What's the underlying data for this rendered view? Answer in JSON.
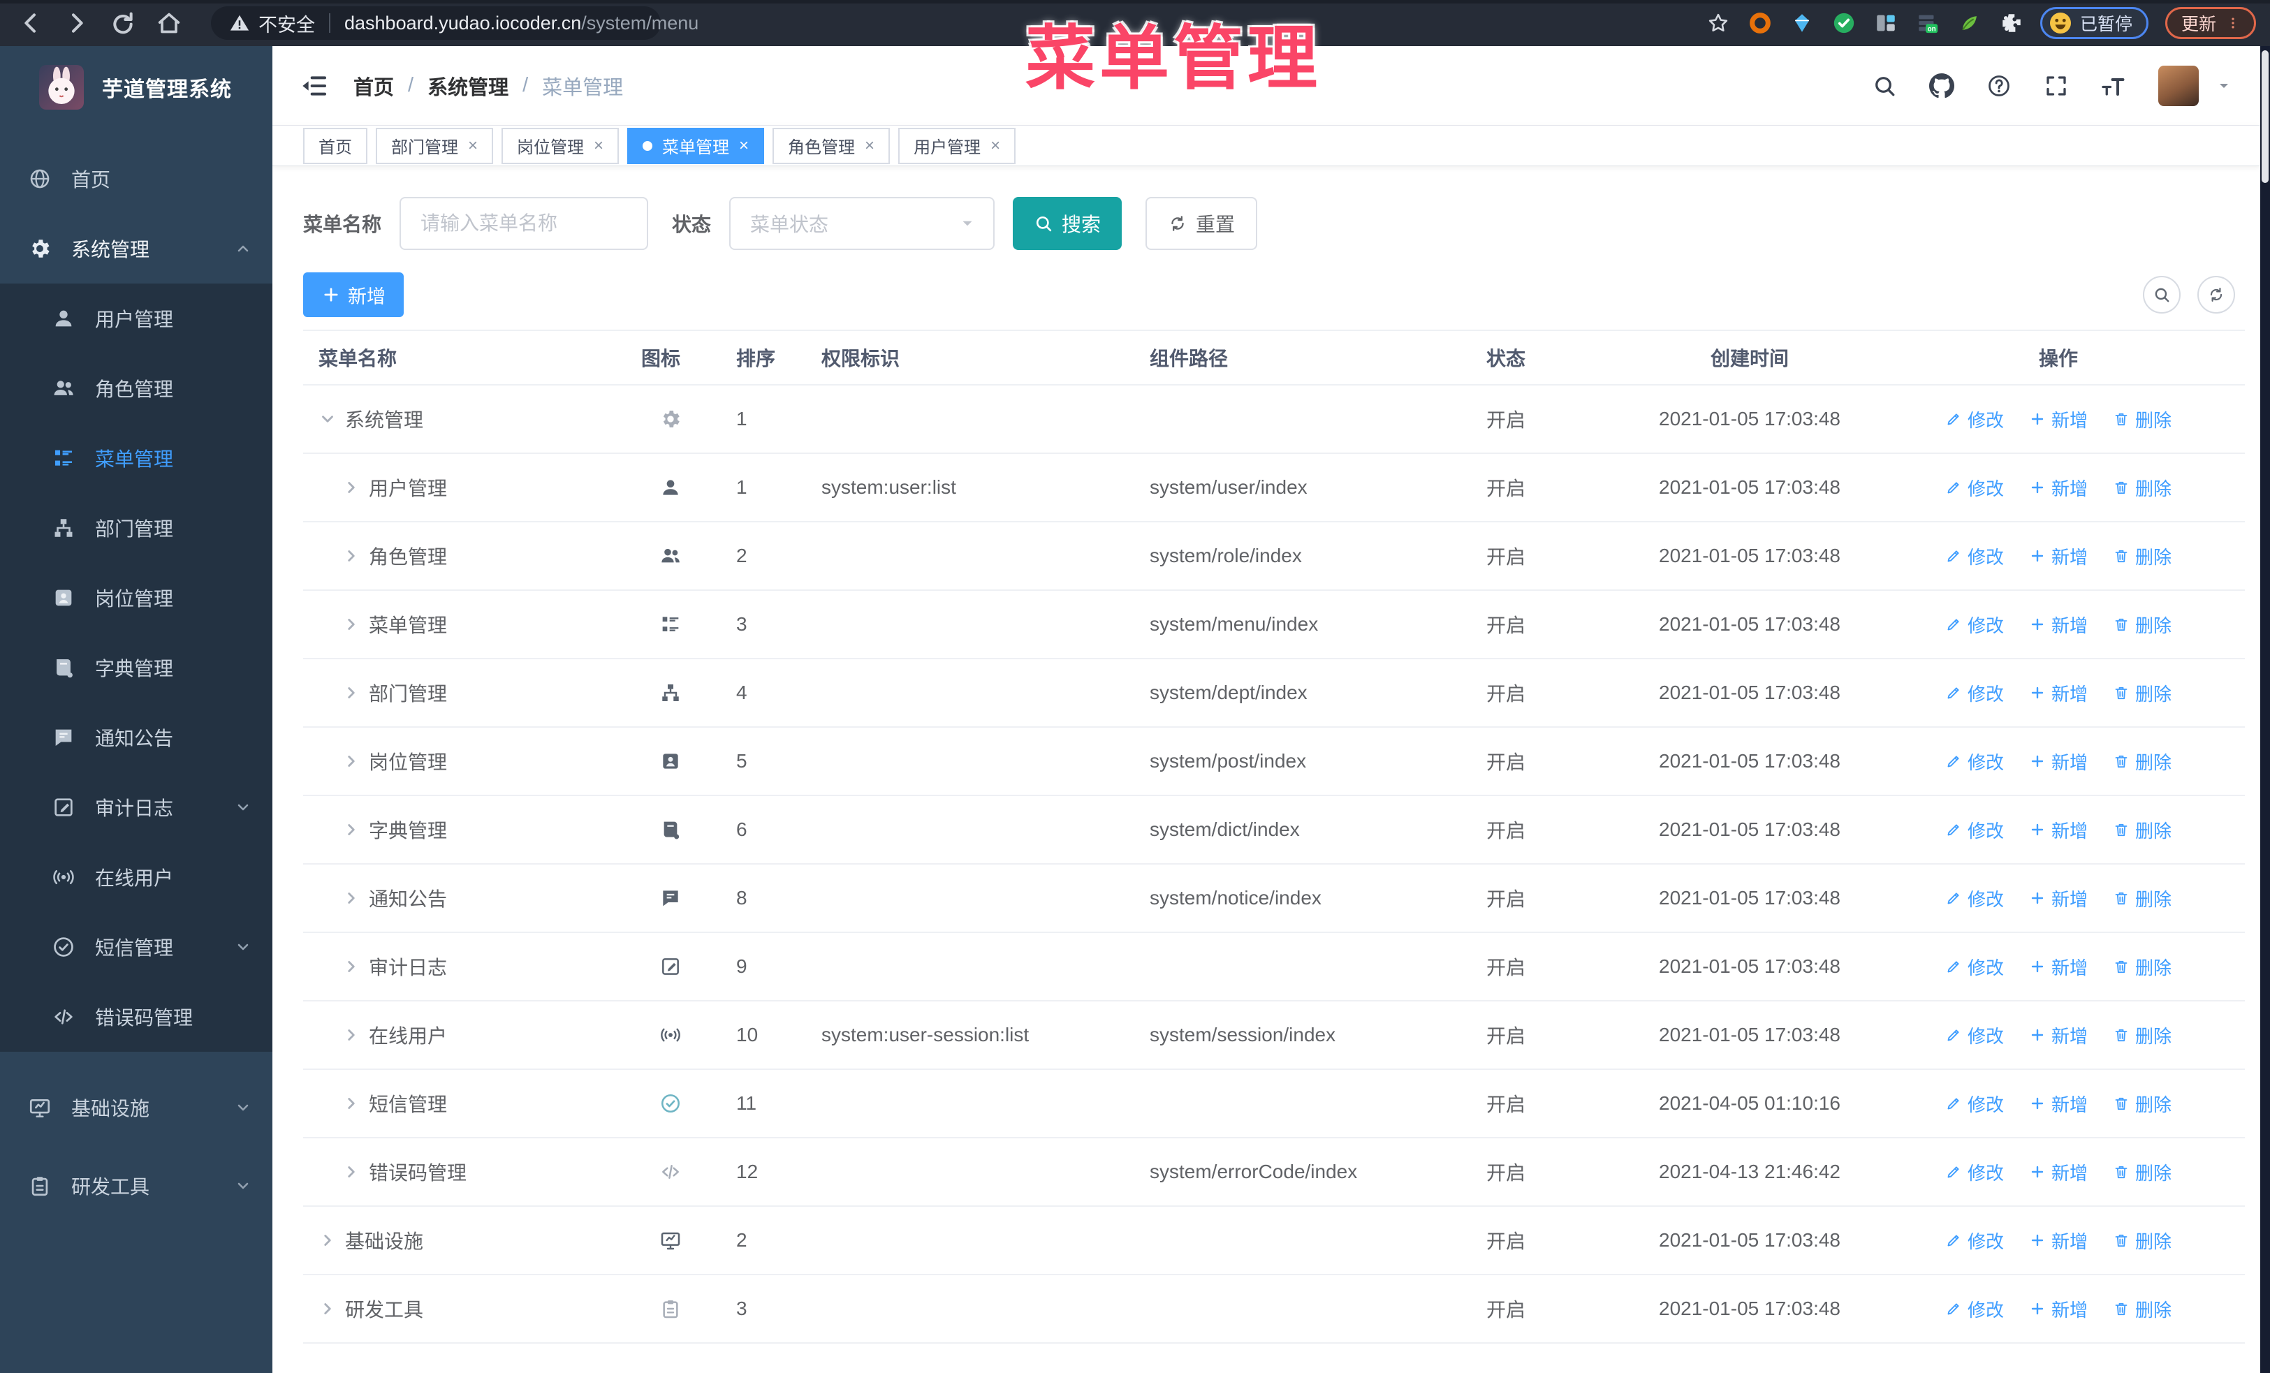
{
  "browser": {
    "security_label": "不安全",
    "url_host": "dashboard.yudao.iocoder.cn",
    "url_path": "/system/menu",
    "paused_badge": "已暂停",
    "update_label": "更新"
  },
  "overlay": {
    "text": "菜单管理",
    "color": "#fa4567"
  },
  "colors": {
    "accent_blue": "#409eff",
    "search_teal": "#17a3a3",
    "sidebar_bg": "#2e4459",
    "sidebar_submenu_bg": "#233242",
    "browser_bar": "#262c37"
  },
  "sidebar": {
    "app_title": "芋道管理系统",
    "items": [
      {
        "label": "首页",
        "icon": "globe",
        "level": 1
      },
      {
        "label": "系统管理",
        "icon": "gear",
        "level": 1,
        "head": true,
        "chevron": "up"
      },
      {
        "label": "用户管理",
        "icon": "user",
        "level": 2
      },
      {
        "label": "角色管理",
        "icon": "users",
        "level": 2
      },
      {
        "label": "菜单管理",
        "icon": "ttable",
        "level": 2,
        "active": true
      },
      {
        "label": "部门管理",
        "icon": "tree",
        "level": 2
      },
      {
        "label": "岗位管理",
        "icon": "badge",
        "level": 2
      },
      {
        "label": "字典管理",
        "icon": "book",
        "level": 2
      },
      {
        "label": "通知公告",
        "icon": "chat",
        "level": 2
      },
      {
        "label": "审计日志",
        "icon": "editdoc",
        "level": 2,
        "chevron": "down"
      },
      {
        "label": "在线用户",
        "icon": "online",
        "level": 2
      },
      {
        "label": "短信管理",
        "icon": "shcheck",
        "level": 2,
        "chevron": "down"
      },
      {
        "label": "错误码管理",
        "icon": "code",
        "level": 2
      },
      {
        "label": "基础设施",
        "icon": "monitor",
        "level": 1,
        "chevron": "down",
        "big": true,
        "gap": true
      },
      {
        "label": "研发工具",
        "icon": "clip",
        "level": 1,
        "chevron": "down",
        "big": true
      }
    ]
  },
  "breadcrumb": [
    "首页",
    "系统管理",
    "菜单管理"
  ],
  "tabs": [
    {
      "label": "首页",
      "closable": false,
      "active": false
    },
    {
      "label": "部门管理",
      "closable": true,
      "active": false
    },
    {
      "label": "岗位管理",
      "closable": true,
      "active": false
    },
    {
      "label": "菜单管理",
      "closable": true,
      "active": true
    },
    {
      "label": "角色管理",
      "closable": true,
      "active": false
    },
    {
      "label": "用户管理",
      "closable": true,
      "active": false
    }
  ],
  "filters": {
    "name_label": "菜单名称",
    "name_placeholder": "请输入菜单名称",
    "status_label": "状态",
    "status_placeholder": "菜单状态",
    "search_label": "搜索",
    "reset_label": "重置"
  },
  "toolbar": {
    "add_label": "新增"
  },
  "table": {
    "columns": [
      "菜单名称",
      "图标",
      "排序",
      "权限标识",
      "组件路径",
      "状态",
      "创建时间",
      "操作"
    ],
    "op_labels": {
      "edit": "修改",
      "add": "新增",
      "delete": "删除"
    },
    "rows": [
      {
        "name": "系统管理",
        "icon": "gear",
        "tone": "light",
        "level": 1,
        "expanded": true,
        "sort": "1",
        "perm": "",
        "path": "",
        "status": "开启",
        "time": "2021-01-05 17:03:48"
      },
      {
        "name": "用户管理",
        "icon": "user",
        "tone": "dark",
        "level": 2,
        "expanded": false,
        "sort": "1",
        "perm": "system:user:list",
        "path": "system/user/index",
        "status": "开启",
        "time": "2021-01-05 17:03:48"
      },
      {
        "name": "角色管理",
        "icon": "users",
        "tone": "dark",
        "level": 2,
        "expanded": false,
        "sort": "2",
        "perm": "",
        "path": "system/role/index",
        "status": "开启",
        "time": "2021-01-05 17:03:48"
      },
      {
        "name": "菜单管理",
        "icon": "ttable",
        "tone": "dark",
        "level": 2,
        "expanded": false,
        "sort": "3",
        "perm": "",
        "path": "system/menu/index",
        "status": "开启",
        "time": "2021-01-05 17:03:48"
      },
      {
        "name": "部门管理",
        "icon": "tree",
        "tone": "dark",
        "level": 2,
        "expanded": false,
        "sort": "4",
        "perm": "",
        "path": "system/dept/index",
        "status": "开启",
        "time": "2021-01-05 17:03:48"
      },
      {
        "name": "岗位管理",
        "icon": "badge",
        "tone": "dark",
        "level": 2,
        "expanded": false,
        "sort": "5",
        "perm": "",
        "path": "system/post/index",
        "status": "开启",
        "time": "2021-01-05 17:03:48"
      },
      {
        "name": "字典管理",
        "icon": "book",
        "tone": "dark",
        "level": 2,
        "expanded": false,
        "sort": "6",
        "perm": "",
        "path": "system/dict/index",
        "status": "开启",
        "time": "2021-01-05 17:03:48"
      },
      {
        "name": "通知公告",
        "icon": "chat",
        "tone": "dark",
        "level": 2,
        "expanded": false,
        "sort": "8",
        "perm": "",
        "path": "system/notice/index",
        "status": "开启",
        "time": "2021-01-05 17:03:48"
      },
      {
        "name": "审计日志",
        "icon": "editdoc",
        "tone": "dark",
        "level": 2,
        "expanded": false,
        "sort": "9",
        "perm": "",
        "path": "",
        "status": "开启",
        "time": "2021-01-05 17:03:48"
      },
      {
        "name": "在线用户",
        "icon": "online",
        "tone": "dark",
        "level": 2,
        "expanded": false,
        "sort": "10",
        "perm": "system:user-session:list",
        "path": "system/session/index",
        "status": "开启",
        "time": "2021-01-05 17:03:48"
      },
      {
        "name": "短信管理",
        "icon": "shcheck",
        "tone": "teal",
        "level": 2,
        "expanded": false,
        "sort": "11",
        "perm": "",
        "path": "",
        "status": "开启",
        "time": "2021-04-05 01:10:16"
      },
      {
        "name": "错误码管理",
        "icon": "code",
        "tone": "light",
        "level": 2,
        "expanded": false,
        "sort": "12",
        "perm": "",
        "path": "system/errorCode/index",
        "status": "开启",
        "time": "2021-04-13 21:46:42"
      },
      {
        "name": "基础设施",
        "icon": "monitor",
        "tone": "dark",
        "level": 1,
        "expanded": false,
        "sort": "2",
        "perm": "",
        "path": "",
        "status": "开启",
        "time": "2021-01-05 17:03:48"
      },
      {
        "name": "研发工具",
        "icon": "clip",
        "tone": "light",
        "level": 1,
        "expanded": false,
        "sort": "3",
        "perm": "",
        "path": "",
        "status": "开启",
        "time": "2021-01-05 17:03:48"
      }
    ]
  }
}
